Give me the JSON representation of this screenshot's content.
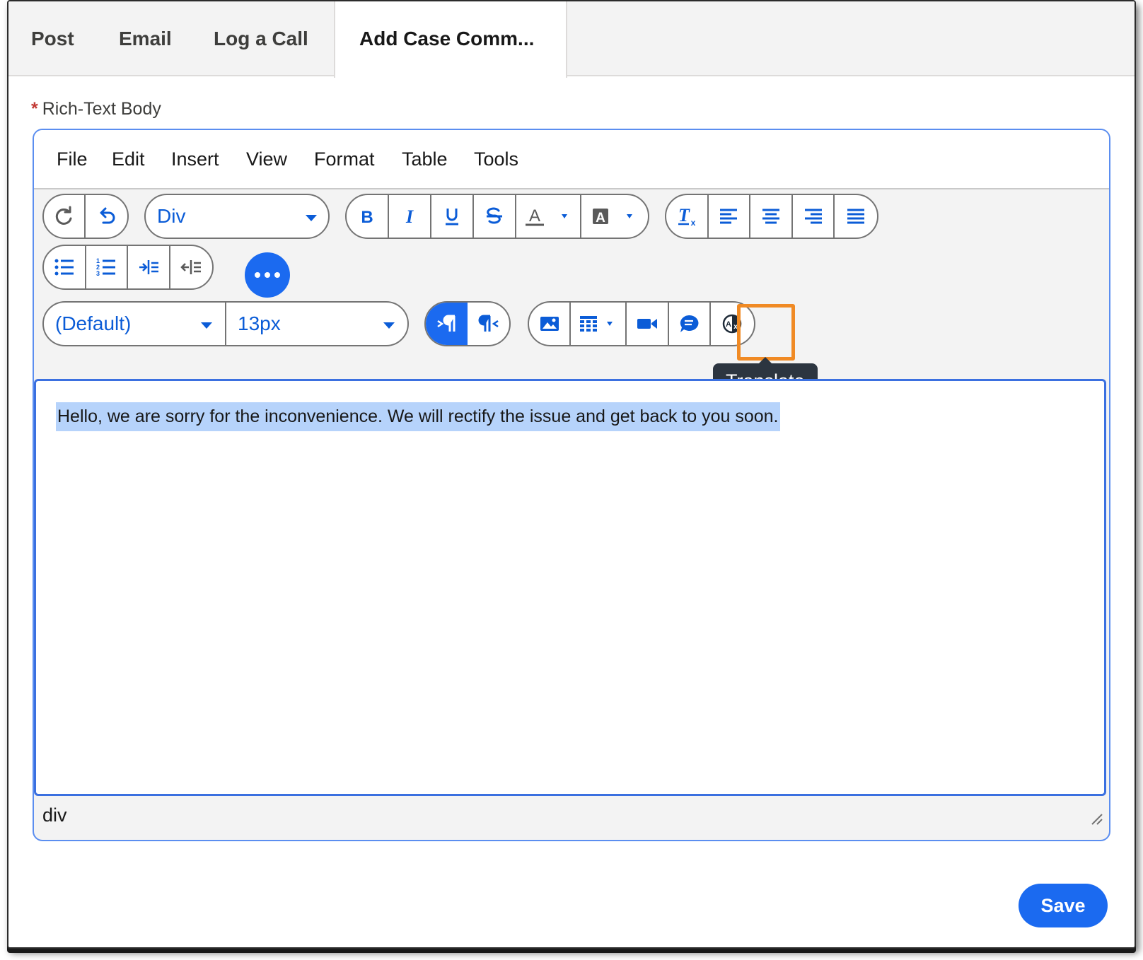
{
  "tabs": [
    {
      "label": "Post"
    },
    {
      "label": "Email"
    },
    {
      "label": "Log a Call"
    },
    {
      "label": "Add Case Comm..."
    }
  ],
  "field": {
    "required_mark": "*",
    "label": "Rich-Text Body"
  },
  "menu": [
    "File",
    "Edit",
    "Insert",
    "View",
    "Format",
    "Table",
    "Tools"
  ],
  "toolbar": {
    "block_format": "Div",
    "font_family": "(Default)",
    "font_size": "13px",
    "tooltip": "Translate"
  },
  "editor": {
    "body_text": "Hello, we are sorry for the inconvenience. We will rectify the issue and get back to you soon.",
    "element_path": "div"
  },
  "actions": {
    "save_label": "Save"
  },
  "colors": {
    "accent": "#1b6af0",
    "icon_blue": "#0b5cd7",
    "highlight": "#f08a24",
    "selection": "#b6d3fb",
    "tooltip_bg": "#2c3540"
  }
}
